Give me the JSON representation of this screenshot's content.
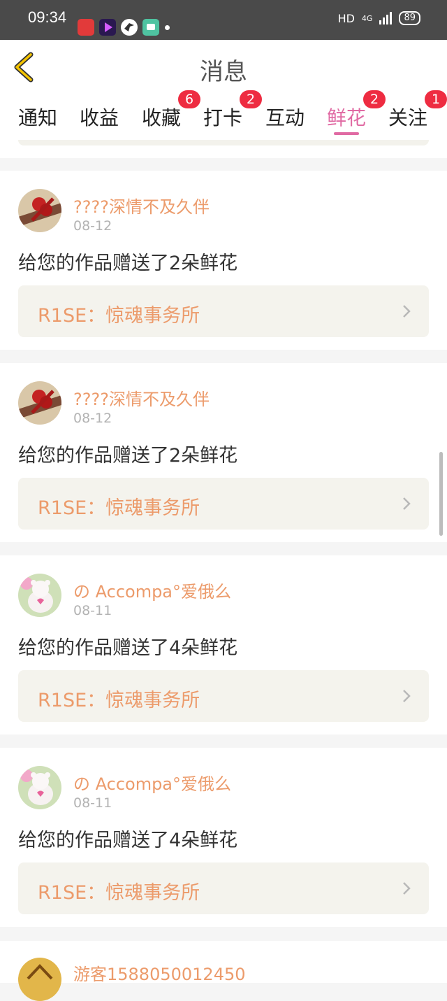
{
  "status_bar": {
    "time": "09:34",
    "network": "HD",
    "signal": "4G",
    "battery": "89"
  },
  "header": {
    "title": "消息"
  },
  "tabs": [
    {
      "label": "通知",
      "badge": ""
    },
    {
      "label": "收益",
      "badge": ""
    },
    {
      "label": "收藏",
      "badge": "6"
    },
    {
      "label": "打卡",
      "badge": "2"
    },
    {
      "label": "互动",
      "badge": ""
    },
    {
      "label": "鲜花",
      "badge": "2",
      "active": true
    },
    {
      "label": "关注",
      "badge": "1"
    }
  ],
  "messages": [
    {
      "user": "????深情不及久伴",
      "date": "08-12",
      "text": "给您的作品赠送了2朵鲜花",
      "work": "R1SE：惊魂事务所",
      "avatar": "rose-avatar"
    },
    {
      "user": "????深情不及久伴",
      "date": "08-12",
      "text": "给您的作品赠送了2朵鲜花",
      "work": "R1SE：惊魂事务所",
      "avatar": "rose-avatar"
    },
    {
      "user": "の Accompa°爱俄么",
      "date": "08-11",
      "text": "给您的作品赠送了4朵鲜花",
      "work": "R1SE：惊魂事务所",
      "avatar": "bear-avatar"
    },
    {
      "user": "の Accompa°爱俄么",
      "date": "08-11",
      "text": "给您的作品赠送了4朵鲜花",
      "work": "R1SE：惊魂事务所",
      "avatar": "bear-avatar"
    }
  ],
  "partial_item": {
    "user": "游客1588050012450"
  },
  "colors": {
    "accent": "#e06aa3",
    "name": "#ec9b6b",
    "badge": "#ee2c41"
  }
}
